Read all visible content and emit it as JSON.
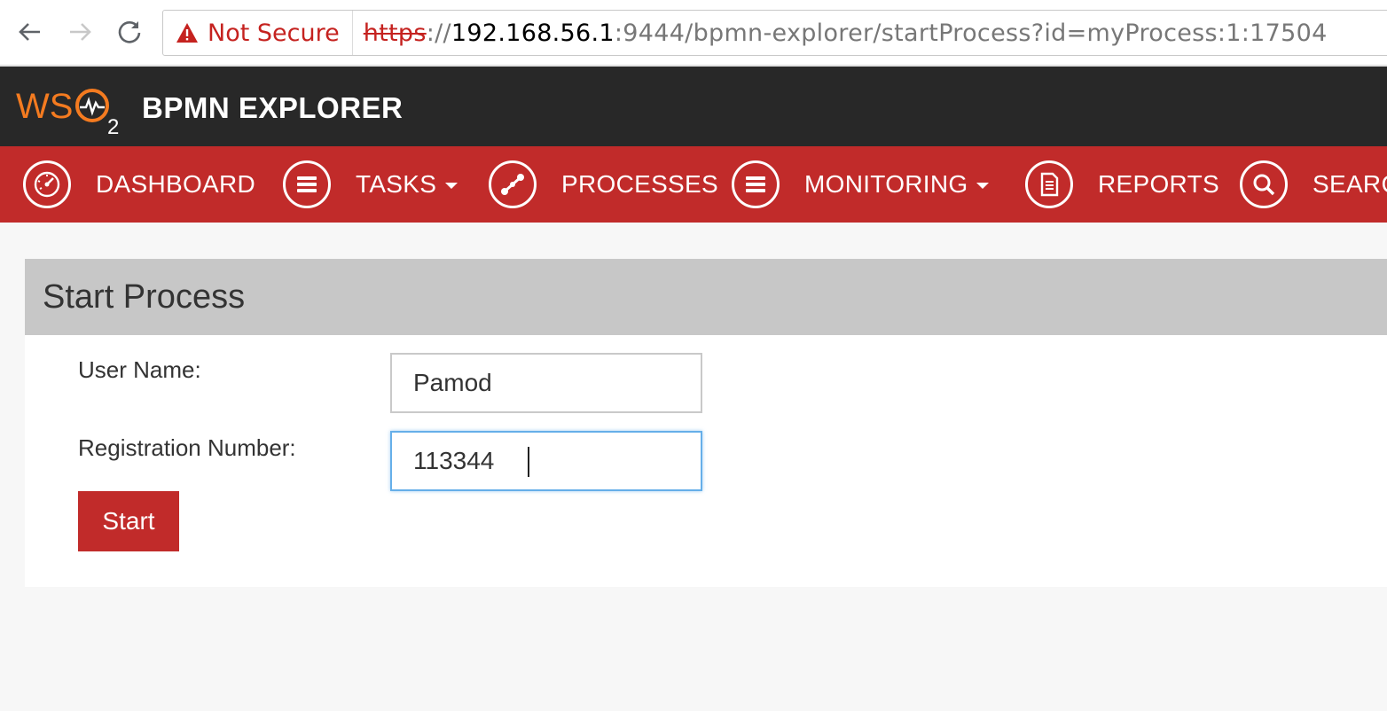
{
  "browser": {
    "security_label": "Not Secure",
    "url_scheme": "https",
    "url_sep": "://",
    "url_host": "192.168.56.1",
    "url_rest": ":9444/bpmn-explorer/startProcess?id=myProcess:1:17504"
  },
  "app": {
    "title": "BPMN EXPLORER",
    "logo_text": "WSO2",
    "brand_color": "#c12b2a",
    "header_color": "#282828",
    "logo_accent": "#f47b20"
  },
  "nav": {
    "items": [
      {
        "label": "DASHBOARD",
        "icon": "dashboard-gauge-icon",
        "dropdown": false
      },
      {
        "label": "TASKS",
        "icon": "list-icon",
        "dropdown": true
      },
      {
        "label": "PROCESSES",
        "icon": "process-icon",
        "dropdown": false
      },
      {
        "label": "MONITORING",
        "icon": "list-icon",
        "dropdown": true
      },
      {
        "label": "REPORTS",
        "icon": "document-icon",
        "dropdown": false
      },
      {
        "label": "SEARC",
        "icon": "search-icon",
        "dropdown": false
      }
    ]
  },
  "panel": {
    "title": "Start Process",
    "fields": [
      {
        "label": "User Name:",
        "value": "Pamod"
      },
      {
        "label": "Registration Number:",
        "value": "113344"
      }
    ],
    "submit_label": "Start"
  }
}
